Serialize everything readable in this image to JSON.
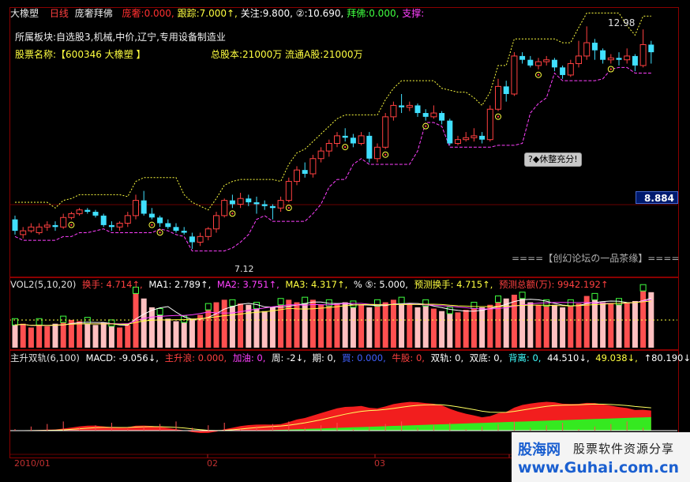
{
  "header": {
    "stock_name": "大橡塑",
    "period": "日线",
    "indicator": "庞奢拜佛",
    "pangshe_label": "庞奢:",
    "pangshe_value": "0.000,",
    "track_label": "跟踪:",
    "track_value": "7.000↑,",
    "watch_label": "关注:",
    "watch_value": "9.800,",
    "circle2_label": "②:",
    "circle2_value": "10.690,",
    "baifo_label": "拜佛:",
    "baifo_value": "0.000,",
    "support_label": "支撑:",
    "support_value": ""
  },
  "info": {
    "sector_line": "所属板块:自选股3,机械,中价,辽宁,专用设备制造业",
    "name_line": "股票名称:【600346 大橡塑  】",
    "capital_line": "总股本:21000万  流通A股:21000万",
    "current_price": "8.884",
    "high_label": "12.98",
    "low_label": "7.12",
    "callout_text": "?◆休整充分!",
    "forum_text": "====【创幻论坛の一品茶缘】===="
  },
  "vol": {
    "title": "VOL2(5,10,20)",
    "turnover": "换手: 4.714↑,",
    "ma1": "MA1: 2.789↑,",
    "ma2": "MA2: 3.751↑,",
    "ma3": "MA3: 4.317↑,",
    "circle5": "% ⑤: 5.000,",
    "pred_turnover": "预测换手: 4.715↑,",
    "pred_amount": "预测总额(万): 9942.192↑"
  },
  "macd": {
    "title": "主升双轨(6,100)",
    "macd": "MACD: -9.056↓,",
    "zhushenglang": "主升浪: 0.000,",
    "jiayou": "加油: 0,",
    "zhou": "周: -2↓,",
    "qi": "期: 0,",
    "mai": "買: 0.000,",
    "niugu": "牛股: 0,",
    "shuanggui": "双轨: 0,",
    "shuangdi": "双底: 0,",
    "beili": "背离: 0,",
    "v1": "44.510↓,",
    "v2": "49.038↓,",
    "v3": "↑80.190↓,"
  },
  "date_axis": [
    "2010/01",
    "02",
    "03"
  ],
  "watermark": {
    "brand": "股海网",
    "slogan": "股票软件资源分享",
    "url": "www.Guhai.com.cn"
  },
  "chart_data": {
    "type": "candlestick",
    "symbol": "600346",
    "price_range": [
      6.5,
      13.3
    ],
    "candles": [
      {
        "o": 7.9,
        "c": 7.6,
        "h": 8.0,
        "l": 7.5
      },
      {
        "o": 7.5,
        "c": 7.6,
        "h": 7.7,
        "l": 7.4
      },
      {
        "o": 7.6,
        "c": 7.7,
        "h": 7.8,
        "l": 7.55
      },
      {
        "o": 7.55,
        "c": 7.7,
        "h": 7.8,
        "l": 7.5
      },
      {
        "o": 7.7,
        "c": 7.75,
        "h": 7.85,
        "l": 7.6
      },
      {
        "o": 7.75,
        "c": 7.7,
        "h": 7.85,
        "l": 7.6
      },
      {
        "o": 7.7,
        "c": 7.95,
        "h": 8.05,
        "l": 7.65
      },
      {
        "o": 7.95,
        "c": 8.05,
        "h": 8.1,
        "l": 7.9
      },
      {
        "o": 8.05,
        "c": 8.15,
        "h": 8.2,
        "l": 8.0
      },
      {
        "o": 8.15,
        "c": 8.1,
        "h": 8.2,
        "l": 8.05
      },
      {
        "o": 8.1,
        "c": 8.0,
        "h": 8.15,
        "l": 7.95
      },
      {
        "o": 8.0,
        "c": 7.75,
        "h": 8.05,
        "l": 7.7
      },
      {
        "o": 7.75,
        "c": 7.7,
        "h": 7.85,
        "l": 7.6
      },
      {
        "o": 7.7,
        "c": 7.8,
        "h": 7.85,
        "l": 7.6
      },
      {
        "o": 7.8,
        "c": 8.0,
        "h": 8.1,
        "l": 7.7
      },
      {
        "o": 8.0,
        "c": 8.4,
        "h": 8.55,
        "l": 7.9
      },
      {
        "o": 8.4,
        "c": 8.05,
        "h": 8.65,
        "l": 8.0
      },
      {
        "o": 8.05,
        "c": 7.95,
        "h": 8.2,
        "l": 7.9
      },
      {
        "o": 7.95,
        "c": 7.8,
        "h": 8.0,
        "l": 7.7
      },
      {
        "o": 7.8,
        "c": 7.7,
        "h": 7.9,
        "l": 7.65
      },
      {
        "o": 7.7,
        "c": 7.6,
        "h": 7.8,
        "l": 7.55
      },
      {
        "o": 7.6,
        "c": 7.55,
        "h": 7.7,
        "l": 7.5
      },
      {
        "o": 7.45,
        "c": 7.3,
        "h": 7.55,
        "l": 7.12
      },
      {
        "o": 7.3,
        "c": 7.45,
        "h": 7.55,
        "l": 7.2
      },
      {
        "o": 7.45,
        "c": 7.65,
        "h": 7.7,
        "l": 7.35
      },
      {
        "o": 7.65,
        "c": 8.0,
        "h": 8.1,
        "l": 7.55
      },
      {
        "o": 8.0,
        "c": 8.4,
        "h": 8.45,
        "l": 7.95
      },
      {
        "o": 8.4,
        "c": 8.3,
        "h": 8.55,
        "l": 8.2
      },
      {
        "o": 8.3,
        "c": 8.45,
        "h": 8.6,
        "l": 8.2
      },
      {
        "o": 8.45,
        "c": 8.35,
        "h": 8.55,
        "l": 8.25
      },
      {
        "o": 8.35,
        "c": 8.3,
        "h": 8.5,
        "l": 8.05
      },
      {
        "o": 8.3,
        "c": 8.25,
        "h": 8.4,
        "l": 8.15
      },
      {
        "o": 8.25,
        "c": 8.2,
        "h": 8.3,
        "l": 7.9
      },
      {
        "o": 8.2,
        "c": 8.4,
        "h": 8.5,
        "l": 8.1
      },
      {
        "o": 8.4,
        "c": 8.9,
        "h": 9.0,
        "l": 8.35
      },
      {
        "o": 8.9,
        "c": 9.2,
        "h": 9.3,
        "l": 8.8
      },
      {
        "o": 9.2,
        "c": 9.1,
        "h": 9.4,
        "l": 9.0
      },
      {
        "o": 9.1,
        "c": 9.5,
        "h": 9.6,
        "l": 9.0
      },
      {
        "o": 9.5,
        "c": 9.7,
        "h": 9.8,
        "l": 9.4
      },
      {
        "o": 9.7,
        "c": 9.9,
        "h": 10.0,
        "l": 9.55
      },
      {
        "o": 9.9,
        "c": 10.1,
        "h": 10.2,
        "l": 9.8
      },
      {
        "o": 10.1,
        "c": 10.05,
        "h": 10.3,
        "l": 9.95
      },
      {
        "o": 10.05,
        "c": 9.9,
        "h": 10.15,
        "l": 9.8
      },
      {
        "o": 9.9,
        "c": 10.1,
        "h": 10.2,
        "l": 9.85
      },
      {
        "o": 10.1,
        "c": 9.5,
        "h": 10.2,
        "l": 9.4
      },
      {
        "o": 9.5,
        "c": 9.8,
        "h": 9.9,
        "l": 9.4
      },
      {
        "o": 9.8,
        "c": 10.6,
        "h": 10.7,
        "l": 9.75
      },
      {
        "o": 10.6,
        "c": 10.9,
        "h": 11.0,
        "l": 10.5
      },
      {
        "o": 10.9,
        "c": 10.85,
        "h": 11.2,
        "l": 10.7
      },
      {
        "o": 10.85,
        "c": 10.9,
        "h": 11.0,
        "l": 10.75
      },
      {
        "o": 10.9,
        "c": 10.7,
        "h": 10.95,
        "l": 10.6
      },
      {
        "o": 10.7,
        "c": 10.6,
        "h": 10.8,
        "l": 10.5
      },
      {
        "o": 10.6,
        "c": 10.7,
        "h": 10.9,
        "l": 10.55
      },
      {
        "o": 10.7,
        "c": 10.5,
        "h": 10.75,
        "l": 10.4
      },
      {
        "o": 10.5,
        "c": 9.9,
        "h": 10.55,
        "l": 9.85
      },
      {
        "o": 9.9,
        "c": 10.0,
        "h": 10.1,
        "l": 9.85
      },
      {
        "o": 10.0,
        "c": 10.05,
        "h": 10.2,
        "l": 9.95
      },
      {
        "o": 10.05,
        "c": 10.1,
        "h": 10.3,
        "l": 9.95
      },
      {
        "o": 10.1,
        "c": 10.0,
        "h": 10.2,
        "l": 9.9
      },
      {
        "o": 10.0,
        "c": 10.8,
        "h": 10.9,
        "l": 9.95
      },
      {
        "o": 10.8,
        "c": 11.4,
        "h": 11.6,
        "l": 10.75
      },
      {
        "o": 11.4,
        "c": 11.2,
        "h": 11.55,
        "l": 11.0
      },
      {
        "o": 11.2,
        "c": 12.2,
        "h": 12.3,
        "l": 11.15
      },
      {
        "o": 12.2,
        "c": 12.1,
        "h": 12.3,
        "l": 12.0
      },
      {
        "o": 12.1,
        "c": 11.95,
        "h": 12.2,
        "l": 11.9
      },
      {
        "o": 11.95,
        "c": 12.05,
        "h": 12.15,
        "l": 11.85
      },
      {
        "o": 12.05,
        "c": 12.1,
        "h": 12.2,
        "l": 11.95
      },
      {
        "o": 12.1,
        "c": 11.9,
        "h": 12.15,
        "l": 11.8
      },
      {
        "o": 11.9,
        "c": 11.7,
        "h": 11.95,
        "l": 11.6
      },
      {
        "o": 11.7,
        "c": 12.0,
        "h": 12.1,
        "l": 11.65
      },
      {
        "o": 12.0,
        "c": 12.2,
        "h": 12.6,
        "l": 11.9
      },
      {
        "o": 12.2,
        "c": 12.55,
        "h": 12.98,
        "l": 12.1
      },
      {
        "o": 12.55,
        "c": 12.35,
        "h": 12.65,
        "l": 12.1
      },
      {
        "o": 12.35,
        "c": 12.1,
        "h": 12.4,
        "l": 12.0
      },
      {
        "o": 12.1,
        "c": 12.15,
        "h": 12.25,
        "l": 12.0
      },
      {
        "o": 12.15,
        "c": 12.1,
        "h": 12.3,
        "l": 11.95
      },
      {
        "o": 12.1,
        "c": 12.2,
        "h": 12.4,
        "l": 12.0
      },
      {
        "o": 12.2,
        "c": 11.95,
        "h": 12.25,
        "l": 11.8
      },
      {
        "o": 11.95,
        "c": 12.5,
        "h": 12.9,
        "l": 11.9
      },
      {
        "o": 12.5,
        "c": 12.3,
        "h": 12.6,
        "l": 12.0
      }
    ],
    "volumes": [
      1.8,
      1.9,
      1.6,
      1.8,
      1.7,
      1.9,
      2.0,
      2.2,
      2.1,
      1.9,
      1.8,
      2.0,
      1.7,
      1.6,
      1.8,
      4.3,
      3.9,
      3.2,
      2.6,
      2.3,
      2.1,
      2.0,
      2.3,
      2.6,
      3.0,
      3.6,
      3.8,
      3.3,
      3.5,
      3.4,
      3.1,
      2.9,
      3.2,
      3.4,
      3.8,
      3.6,
      3.5,
      3.8,
      3.4,
      3.3,
      3.5,
      3.6,
      3.2,
      3.4,
      3.2,
      3.3,
      3.6,
      3.8,
      3.5,
      3.4,
      3.2,
      3.3,
      3.1,
      2.9,
      2.7,
      2.8,
      3.0,
      3.1,
      3.2,
      3.4,
      3.6,
      3.9,
      4.2,
      3.9,
      3.6,
      3.4,
      3.3,
      3.4,
      3.2,
      3.3,
      3.5,
      4.1,
      3.8,
      3.6,
      3.5,
      3.4,
      3.6,
      3.7,
      4.5,
      4.4
    ],
    "vol_range": [
      0,
      4.7
    ],
    "series": [
      {
        "name": "MA1",
        "value": 2.789
      },
      {
        "name": "MA2",
        "value": 3.751
      },
      {
        "name": "MA3",
        "value": 4.317
      }
    ]
  }
}
